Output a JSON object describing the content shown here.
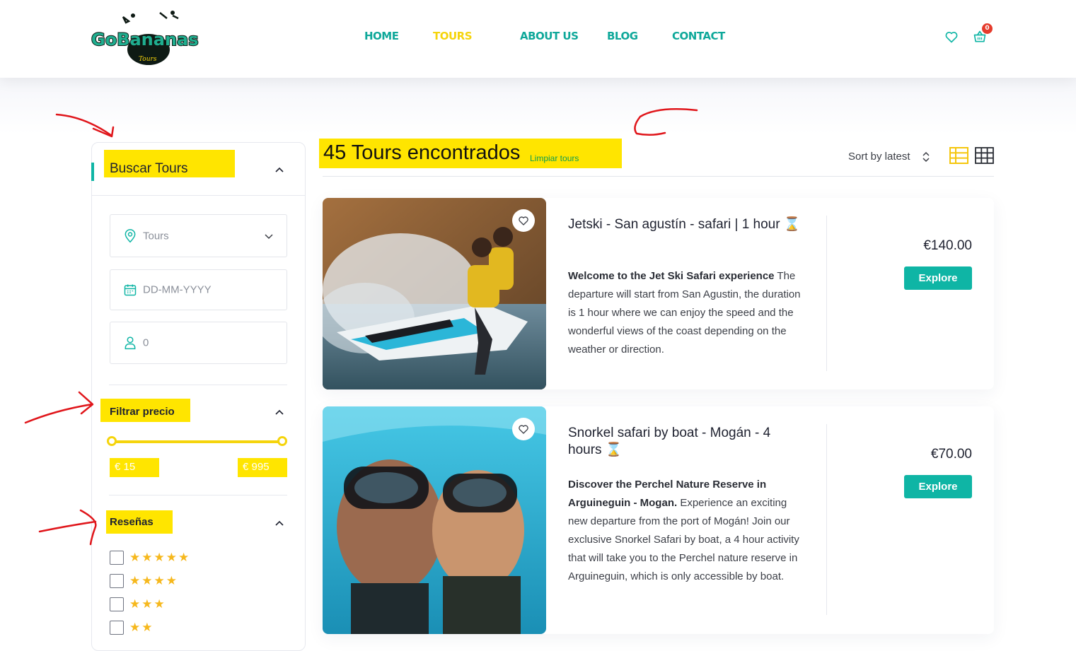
{
  "header": {
    "logo_text": "GoBananas",
    "logo_sub": "Tours",
    "nav": [
      "HOME",
      "TOURS",
      "ABOUT US",
      "BLOG",
      "CONTACT"
    ],
    "active_nav": "TOURS",
    "cart_count": "0",
    "icons": [
      "heart-icon",
      "basket-icon"
    ]
  },
  "sidebar": {
    "search_title": "Buscar Tours",
    "fields": {
      "tour_select": "Tours",
      "date_placeholder": "DD-MM-YYYY",
      "guests": "0"
    },
    "price_filter": {
      "title": "Filtrar precio",
      "min": "€  15",
      "max": "€ 995",
      "min_value": 15,
      "max_value": 995
    },
    "reviews": {
      "title": "Reseñas",
      "options": [
        {
          "stars": "★★★★★",
          "rating": 5
        },
        {
          "stars": "★★★★",
          "rating": 4
        },
        {
          "stars": "★★★",
          "rating": 3
        },
        {
          "stars": "★★",
          "rating": 2
        }
      ]
    }
  },
  "main": {
    "results_title": "45 Tours encontrados",
    "clear_link": "Limpiar tours",
    "sort_label": "Sort by latest",
    "tours": [
      {
        "title": "Jetski - San agustín - safari | 1 hour ⌛",
        "desc_bold": "Welcome to the Jet Ski Safari experience",
        "desc": " The departure will start from San Agustin, the duration is 1 hour where we can enjoy the speed and the wonderful views of the coast depending on the weather or direction.",
        "price": "€140.00",
        "button": "Explore"
      },
      {
        "title": "Snorkel safari by boat - Mogán - 4 hours ⌛",
        "desc_bold": "Discover the Perchel Nature Reserve in Arguineguin - Mogan.",
        "desc": " Experience an exciting new departure from the port of Mogán! Join our exclusive Snorkel Safari by boat, a 4 hour activity that will take you to the Perchel nature reserve in Arguineguin, which is only accessible by boat.",
        "price": "€70.00",
        "button": "Explore"
      }
    ]
  },
  "colors": {
    "teal": "#0fb5a5",
    "yellow": "#f5d40c",
    "highlight": "#ffe500",
    "annotation_red": "#e0161b"
  }
}
